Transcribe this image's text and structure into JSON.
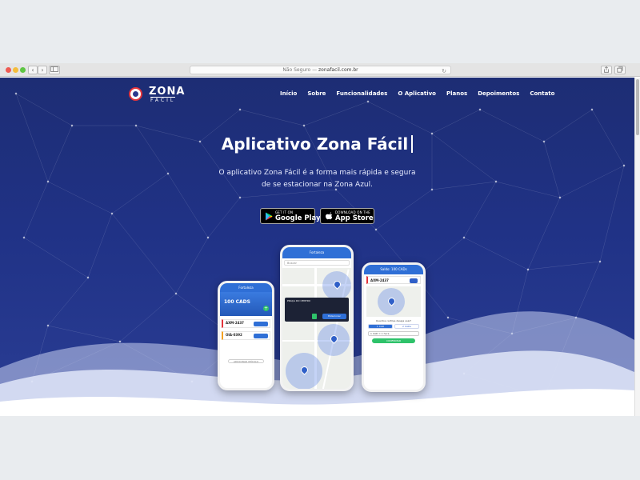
{
  "browser": {
    "address_prefix": "Não Seguro — ",
    "address_site": "zonafacil.com.br",
    "back_icon": "‹",
    "forward_icon": "›"
  },
  "logo": {
    "zona": "ZONA",
    "facil": "FÁCIL"
  },
  "nav": {
    "items": [
      {
        "label": "Início"
      },
      {
        "label": "Sobre"
      },
      {
        "label": "Funcionalidades"
      },
      {
        "label": "O Aplicativo"
      },
      {
        "label": "Planos"
      },
      {
        "label": "Depoimentos"
      },
      {
        "label": "Contato"
      }
    ]
  },
  "hero": {
    "title": "Aplicativo Zona Fácil",
    "subtitle_line1": "O aplicativo Zona Fácil é a forma mais rápida e segura",
    "subtitle_line2": "de se estacionar na Zona Azul."
  },
  "stores": {
    "google_small": "GET IT ON",
    "google_big": "Google Play",
    "apple_small": "Download on the",
    "apple_big": "App Store"
  },
  "phone_left": {
    "city": "Fortaleza",
    "cads": "100 CADS",
    "plates": [
      "AXM-2437",
      "OIA-0392"
    ],
    "add_vehicle": "ADICIONAR VEÍCULO"
  },
  "phone_center": {
    "city": "Fortaleza",
    "search": "Buscar",
    "popup_title": "PRAÇA DO CENTRO",
    "popup_button": "Estacionar"
  },
  "phone_right": {
    "header": "Saldo: 100 CADs",
    "plate": "AXM-2437",
    "question": "Quantos cartões deseja usar?",
    "option_1": "1 CAD",
    "option_2": "2 CADs",
    "select": "1 CAD = 1 hora",
    "confirm": "CONFIRMAR"
  },
  "colors": {
    "hero_bg": "#203286",
    "accent_blue": "#2f6fd6",
    "green": "#2ec26a",
    "red": "#e3343b"
  }
}
